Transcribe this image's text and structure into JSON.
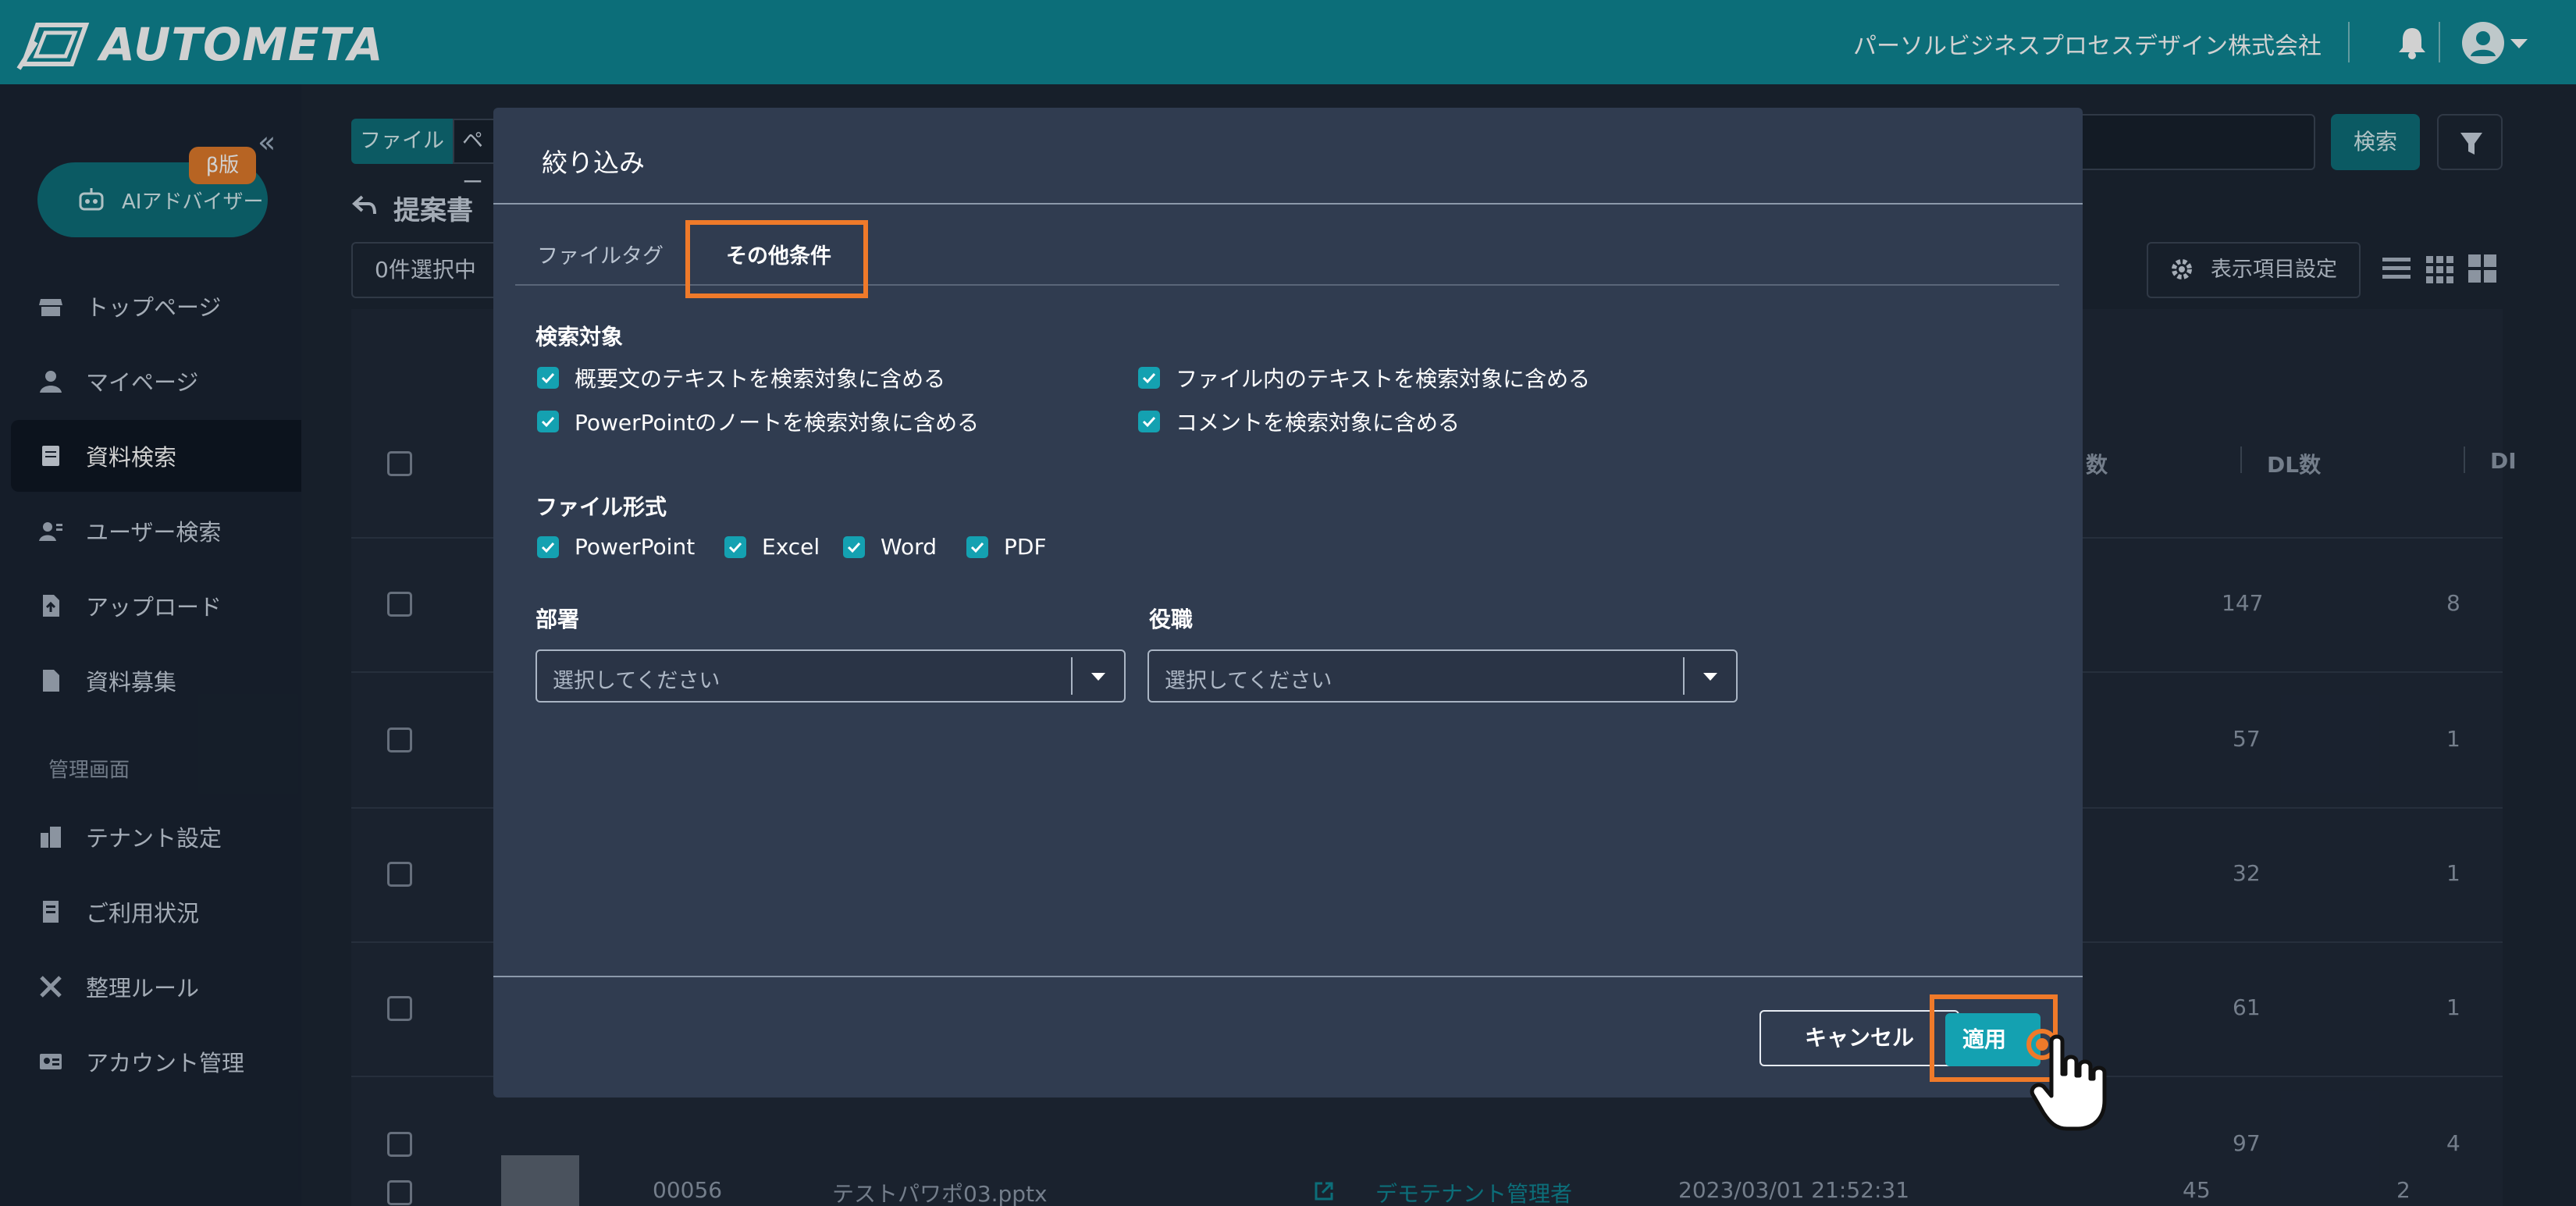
{
  "header": {
    "app_name": "AUTOMETA",
    "company": "パーソルビジネスプロセスデザイン株式会社"
  },
  "sidebar": {
    "collapse_glyph": "«",
    "ai_advisor": {
      "label": "AIアドバイザー",
      "badge": "β版"
    },
    "items": [
      {
        "label": "トップページ",
        "icon": "store-icon"
      },
      {
        "label": "マイページ",
        "icon": "user-icon"
      },
      {
        "label": "資料検索",
        "icon": "document-icon",
        "active": true
      },
      {
        "label": "ユーザー検索",
        "icon": "user-search-icon"
      },
      {
        "label": "アップロード",
        "icon": "upload-file-icon"
      },
      {
        "label": "資料募集",
        "icon": "file-icon"
      }
    ],
    "admin_section": "管理画面",
    "admin_items": [
      {
        "label": "テナント設定",
        "icon": "building-icon"
      },
      {
        "label": "ご利用状況",
        "icon": "report-icon"
      },
      {
        "label": "整理ルール",
        "icon": "tools-icon"
      },
      {
        "label": "アカウント管理",
        "icon": "id-card-icon"
      }
    ]
  },
  "main": {
    "file_chip": "ファイル",
    "page_chip": "ペー",
    "search_button": "検索",
    "page_title": "提案書",
    "selection_count": "0件選択中",
    "column_settings": "表示項目設定",
    "table": {
      "headers": [
        "数",
        "DL数",
        "DI"
      ],
      "rows": [
        {
          "views": "147",
          "dl": "8"
        },
        {
          "views": "57",
          "dl": "1"
        },
        {
          "views": "32",
          "dl": "1"
        },
        {
          "views": "61",
          "dl": "1"
        },
        {
          "views": "97",
          "dl": "4"
        },
        {
          "id": "00056",
          "name": "テストパワポ03.pptx",
          "owner": "デモテナント管理者",
          "date": "2023/03/01 21:52:31",
          "views": "45",
          "dl": "2"
        }
      ]
    }
  },
  "modal": {
    "title": "絞り込み",
    "tabs": [
      {
        "label": "ファイルタグ",
        "active": false
      },
      {
        "label": "その他条件",
        "active": true
      }
    ],
    "search_target": {
      "label": "検索対象",
      "options": [
        {
          "label": "概要文のテキストを検索対象に含める",
          "checked": true
        },
        {
          "label": "ファイル内のテキストを検索対象に含める",
          "checked": true
        },
        {
          "label": "PowerPointのノートを検索対象に含める",
          "checked": true
        },
        {
          "label": "コメントを検索対象に含める",
          "checked": true
        }
      ]
    },
    "file_format": {
      "label": "ファイル形式",
      "options": [
        {
          "label": "PowerPoint",
          "checked": true
        },
        {
          "label": "Excel",
          "checked": true
        },
        {
          "label": "Word",
          "checked": true
        },
        {
          "label": "PDF",
          "checked": true
        }
      ]
    },
    "department": {
      "label": "部署",
      "placeholder": "選択してください"
    },
    "position": {
      "label": "役職",
      "placeholder": "選択してください"
    },
    "cancel_label": "キャンセル",
    "apply_label": "適用"
  },
  "colors": {
    "header": "#0f8794",
    "accent": "#14a1b1",
    "highlight": "#ef7a2a",
    "modal_bg": "#303c50"
  }
}
